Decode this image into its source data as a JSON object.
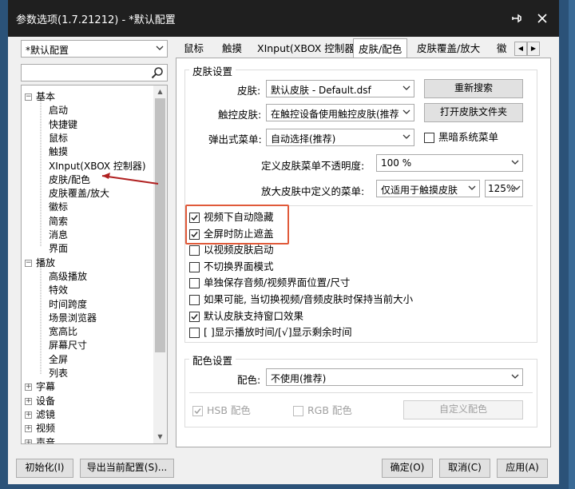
{
  "window": {
    "title": "参数选项(1.7.21212) - *默认配置",
    "pin_icon": "pin-icon",
    "close_icon": "close-icon"
  },
  "left": {
    "profile_select": "*默认配置",
    "search_value": "",
    "tree": [
      {
        "label": "基本",
        "level": 0,
        "expander": "−"
      },
      {
        "label": "启动",
        "level": 1
      },
      {
        "label": "快捷键",
        "level": 1
      },
      {
        "label": "鼠标",
        "level": 1
      },
      {
        "label": "触摸",
        "level": 1
      },
      {
        "label": "XInput(XBOX 控制器)",
        "level": 1
      },
      {
        "label": "皮肤/配色",
        "level": 1
      },
      {
        "label": "皮肤覆盖/放大",
        "level": 1
      },
      {
        "label": "徽标",
        "level": 1
      },
      {
        "label": "简索",
        "level": 1
      },
      {
        "label": "消息",
        "level": 1
      },
      {
        "label": "界面",
        "level": 1
      },
      {
        "label": "播放",
        "level": 0,
        "expander": "−"
      },
      {
        "label": "高级播放",
        "level": 1
      },
      {
        "label": "特效",
        "level": 1
      },
      {
        "label": "时间跨度",
        "level": 1
      },
      {
        "label": "场景浏览器",
        "level": 1
      },
      {
        "label": "宽高比",
        "level": 1
      },
      {
        "label": "屏幕尺寸",
        "level": 1
      },
      {
        "label": "全屏",
        "level": 1
      },
      {
        "label": "列表",
        "level": 1
      },
      {
        "label": "字幕",
        "level": 0,
        "expander": "+"
      },
      {
        "label": "设备",
        "level": 0,
        "expander": "+"
      },
      {
        "label": "滤镜",
        "level": 0,
        "expander": "+"
      },
      {
        "label": "视频",
        "level": 0,
        "expander": "+"
      },
      {
        "label": "声音",
        "level": 0,
        "expander": "+"
      }
    ]
  },
  "tabs": [
    "鼠标",
    "触摸",
    "XInput(XBOX 控制器)",
    "皮肤/配色",
    "皮肤覆盖/放大",
    "徽"
  ],
  "active_tab": "皮肤/配色",
  "skin": {
    "group_title": "皮肤设置",
    "skin_label": "皮肤:",
    "skin_value": "默认皮肤 - Default.dsf",
    "rescan_button": "重新搜索",
    "touch_skin_label": "触控皮肤:",
    "touch_skin_value": "在触控设备使用触控皮肤(推荐",
    "open_folder_button": "打开皮肤文件夹",
    "popup_menu_label": "弹出式菜单:",
    "popup_menu_value": "自动选择(推荐)",
    "dark_menu_label": "黑暗系统菜单",
    "dark_menu_checked": false,
    "opacity_label": "定义皮肤菜单不透明度:",
    "opacity_value": "100 %",
    "zoom_menu_label": "放大皮肤中定义的菜单:",
    "zoom_menu_value": "仅适用于触摸皮肤",
    "zoom_percent_value": "125%",
    "options": [
      {
        "label": "视频下自动隐藏",
        "checked": true
      },
      {
        "label": "全屏时防止遮盖",
        "checked": true
      },
      {
        "label": "以视频皮肤启动",
        "checked": false
      },
      {
        "label": "不切换界面模式",
        "checked": false
      },
      {
        "label": "单独保存音频/视频界面位置/尺寸",
        "checked": false
      },
      {
        "label": "如果可能, 当切换视频/音频皮肤时保持当前大小",
        "checked": false
      },
      {
        "label": "默认皮肤支持窗口效果",
        "checked": true
      },
      {
        "label": "[ ]显示播放时间/[√]显示剩余时间",
        "checked": false
      }
    ]
  },
  "color": {
    "group_title": "配色设置",
    "scheme_label": "配色:",
    "scheme_value": "不使用(推荐)",
    "hsb_label": "HSB 配色",
    "hsb_checked": true,
    "rgb_label": "RGB 配色",
    "rgb_checked": false,
    "custom_button": "自定义配色"
  },
  "footer": {
    "init_button": "初始化(I)",
    "export_button": "导出当前配置(S)...",
    "ok_button": "确定(O)",
    "cancel_button": "取消(C)",
    "apply_button": "应用(A)"
  }
}
